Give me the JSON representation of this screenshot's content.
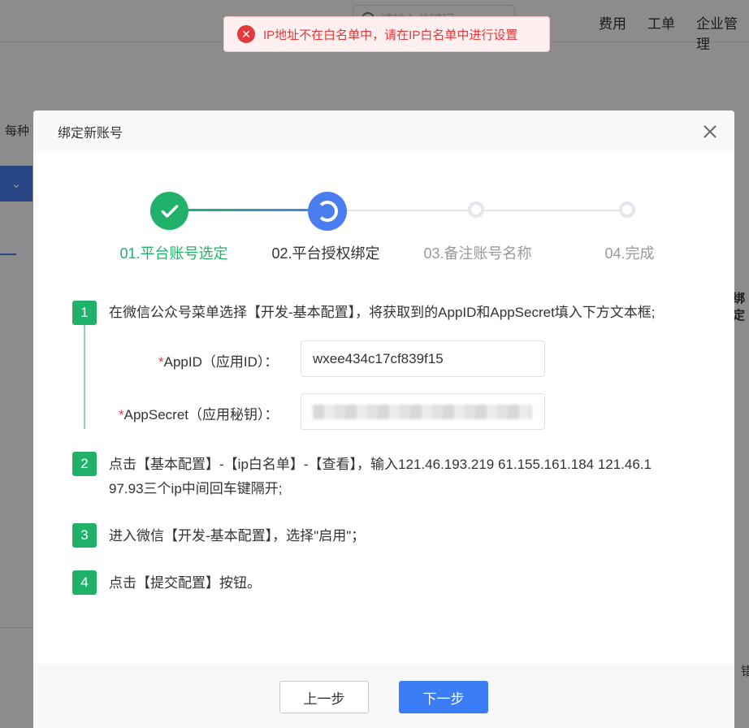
{
  "background": {
    "search_placeholder": "请输入关键词",
    "nav": [
      "费用",
      "工单",
      "企业管理"
    ],
    "side_text": "每种",
    "right_text": "绑定",
    "right_text2": "错"
  },
  "toast": {
    "message": "IP地址不在白名单中，请在IP白名单中进行设置",
    "color": "#e5383b"
  },
  "modal": {
    "title": "绑定新账号",
    "steps": [
      {
        "label": "01.平台账号选定",
        "status": "done"
      },
      {
        "label": "02.平台授权绑定",
        "status": "active"
      },
      {
        "label": "03.备注账号名称",
        "status": "pending"
      },
      {
        "label": "04.完成",
        "status": "pending"
      }
    ],
    "instructions": [
      {
        "num": "1",
        "text": "在微信公众号菜单选择【开发-基本配置】，将获取到的AppID和AppSecret填入下方文本框;"
      },
      {
        "num": "2",
        "text_line1": "点击【基本配置】-【ip白名单】-【查看】，输入121.46.193.219 61.155.161.184 121.46.1",
        "text_line2": "97.93三个ip中间回车键隔开;"
      },
      {
        "num": "3",
        "text": "进入微信【开发-基本配置】，选择\"启用\"；"
      },
      {
        "num": "4",
        "text": "点击【提交配置】按钮。"
      }
    ],
    "fields": {
      "appid_required": "*",
      "appid_label": "AppID（应用ID）：",
      "appid_value": "wxee434c17cf839f15",
      "appsecret_required": "*",
      "appsecret_label": "AppSecret（应用秘钥）：",
      "appsecret_value": "(masked)"
    },
    "footer": {
      "prev_label": "上一步",
      "next_label": "下一步"
    },
    "colors": {
      "done": "#20b26b",
      "active": "#4a7ef0",
      "primary_button": "#3b7cf7"
    }
  }
}
